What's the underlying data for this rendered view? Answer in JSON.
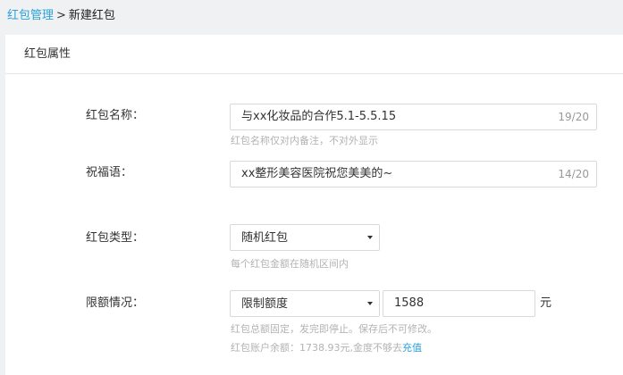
{
  "breadcrumb": {
    "parent": "红包管理",
    "separator": ">",
    "current": "新建红包"
  },
  "section": {
    "title": "红包属性"
  },
  "form": {
    "name": {
      "label": "红包名称：",
      "value": "与xx化妆品的合作5.1-5.5.15",
      "counter": "19/20",
      "hint": "红包名称仅对内备注，不对外显示"
    },
    "greeting": {
      "label": "祝福语：",
      "value": "xx整形美容医院祝您美美的~",
      "counter": "14/20"
    },
    "type": {
      "label": "红包类型：",
      "selected": "随机红包",
      "hint": "每个红包金额在随机区间内"
    },
    "limit": {
      "label": "限额情况：",
      "selected": "限制额度",
      "amount": "1588",
      "unit": "元",
      "hint": "红包总额固定，发完即停止。保存后不可修改。",
      "balance_text": "红包账户余额：1738.93元,金度不够去",
      "recharge_label": "充值"
    }
  },
  "colors": {
    "link": "#2aa1d8",
    "hint": "#b3b3b3",
    "border": "#d9d9d9",
    "page_bg": "#f0f1f3"
  },
  "icons": {
    "dropdown": "chevron-down-icon"
  }
}
